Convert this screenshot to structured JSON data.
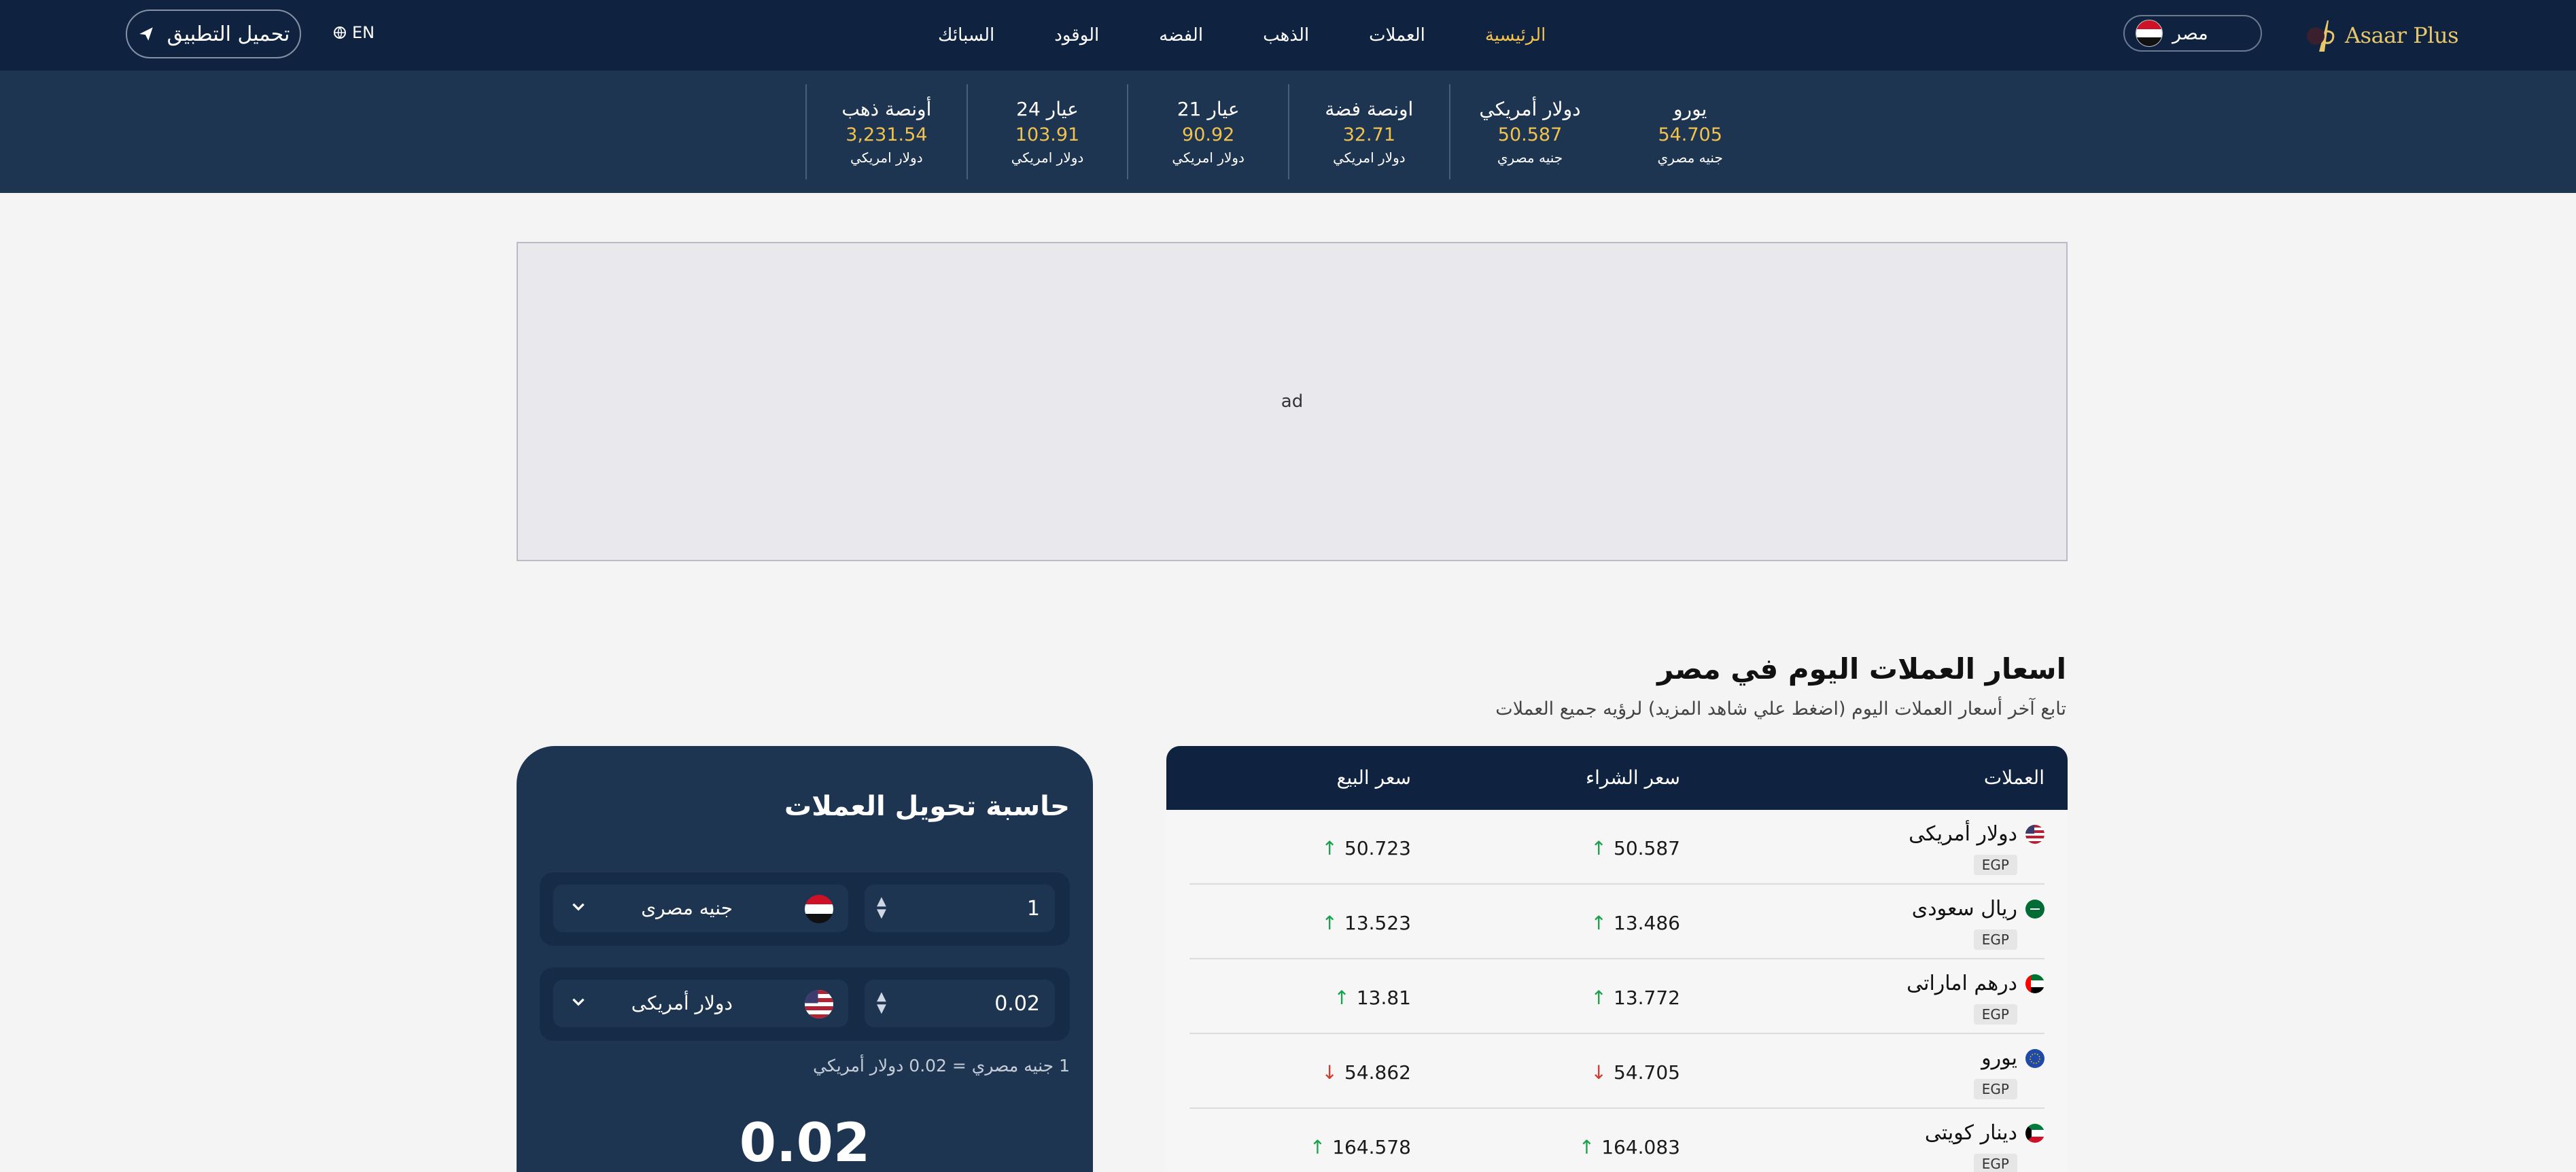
{
  "nav": {
    "brand": "Asaar Plus",
    "country": "مصر",
    "links": [
      "الرئيسية",
      "العملات",
      "الذهب",
      "الفضه",
      "الوقود",
      "السبائك"
    ],
    "lang": "EN",
    "app_button": "تحميل التطبيق",
    "accent": "#f2c14e"
  },
  "ticker": [
    {
      "title": "أونصة ذهب",
      "value": "3,231.54",
      "unit": "دولار امريكي"
    },
    {
      "title": "عيار 24",
      "value": "103.91",
      "unit": "دولار امريكي"
    },
    {
      "title": "عيار 21",
      "value": "90.92",
      "unit": "دولار امريكي"
    },
    {
      "title": "اونصة فضة",
      "value": "32.71",
      "unit": "دولار امريكي"
    },
    {
      "title": "دولار أمريكي",
      "value": "50.587",
      "unit": "جنيه مصري"
    },
    {
      "title": "يورو",
      "value": "54.705",
      "unit": "جنيه مصري"
    }
  ],
  "ad": {
    "label": "ad"
  },
  "section": {
    "title": "اسعار العملات اليوم في مصر",
    "subtitle": "تابع آخر أسعار العملات اليوم (اضغط علي شاهد المزيد) لرؤيه جميع العملات"
  },
  "table": {
    "headers": {
      "currency": "العملات",
      "buy": "سعر الشراء",
      "sell": "سعر البيع"
    },
    "rows": [
      {
        "name": "دولار أمريكى",
        "code": "EGP",
        "buy": "50.587",
        "buy_dir": "up",
        "sell": "50.723",
        "sell_dir": "up",
        "flag": "us-flag-icon"
      },
      {
        "name": "ريال سعودى",
        "code": "EGP",
        "buy": "13.486",
        "buy_dir": "up",
        "sell": "13.523",
        "sell_dir": "up",
        "flag": "sa-flag-icon"
      },
      {
        "name": "درهم اماراتى",
        "code": "EGP",
        "buy": "13.772",
        "buy_dir": "up",
        "sell": "13.81",
        "sell_dir": "up",
        "flag": "ae-flag-icon"
      },
      {
        "name": "يورو",
        "code": "EGP",
        "buy": "54.705",
        "buy_dir": "down",
        "sell": "54.862",
        "sell_dir": "down",
        "flag": "eu-flag-icon"
      },
      {
        "name": "دينار كويتى",
        "code": "EGP",
        "buy": "164.083",
        "buy_dir": "up",
        "sell": "164.578",
        "sell_dir": "up",
        "flag": "kw-flag-icon"
      }
    ]
  },
  "converter": {
    "title": "حاسبة تحويل العملات",
    "from": {
      "amount": "1",
      "currency": "جنيه مصرى"
    },
    "to": {
      "amount": "0.02",
      "currency": "دولار أمريكى"
    },
    "note": "1 جنيه مصري = 0.02 دولار أمريكي",
    "result": "0.02"
  }
}
